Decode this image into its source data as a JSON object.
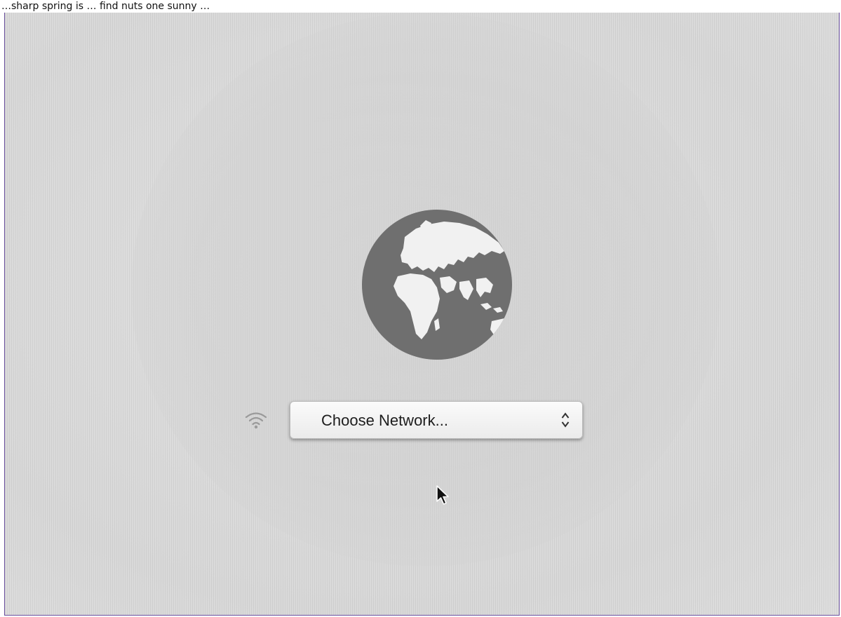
{
  "caption": "…sharp spring is … find nuts one sunny …",
  "screen": {
    "globe_icon": "globe-icon",
    "wifi_icon": "wifi-icon",
    "network_popup": {
      "label": "Choose Network...",
      "stepper_icon": "up-down-chevrons-icon"
    },
    "cursor_icon": "mouse-pointer-icon"
  },
  "colors": {
    "background": "#dcdcdc",
    "globe": "#6f6f6f",
    "popup_border": "#b9b9b9",
    "frame_border": "#6a4f9e"
  }
}
